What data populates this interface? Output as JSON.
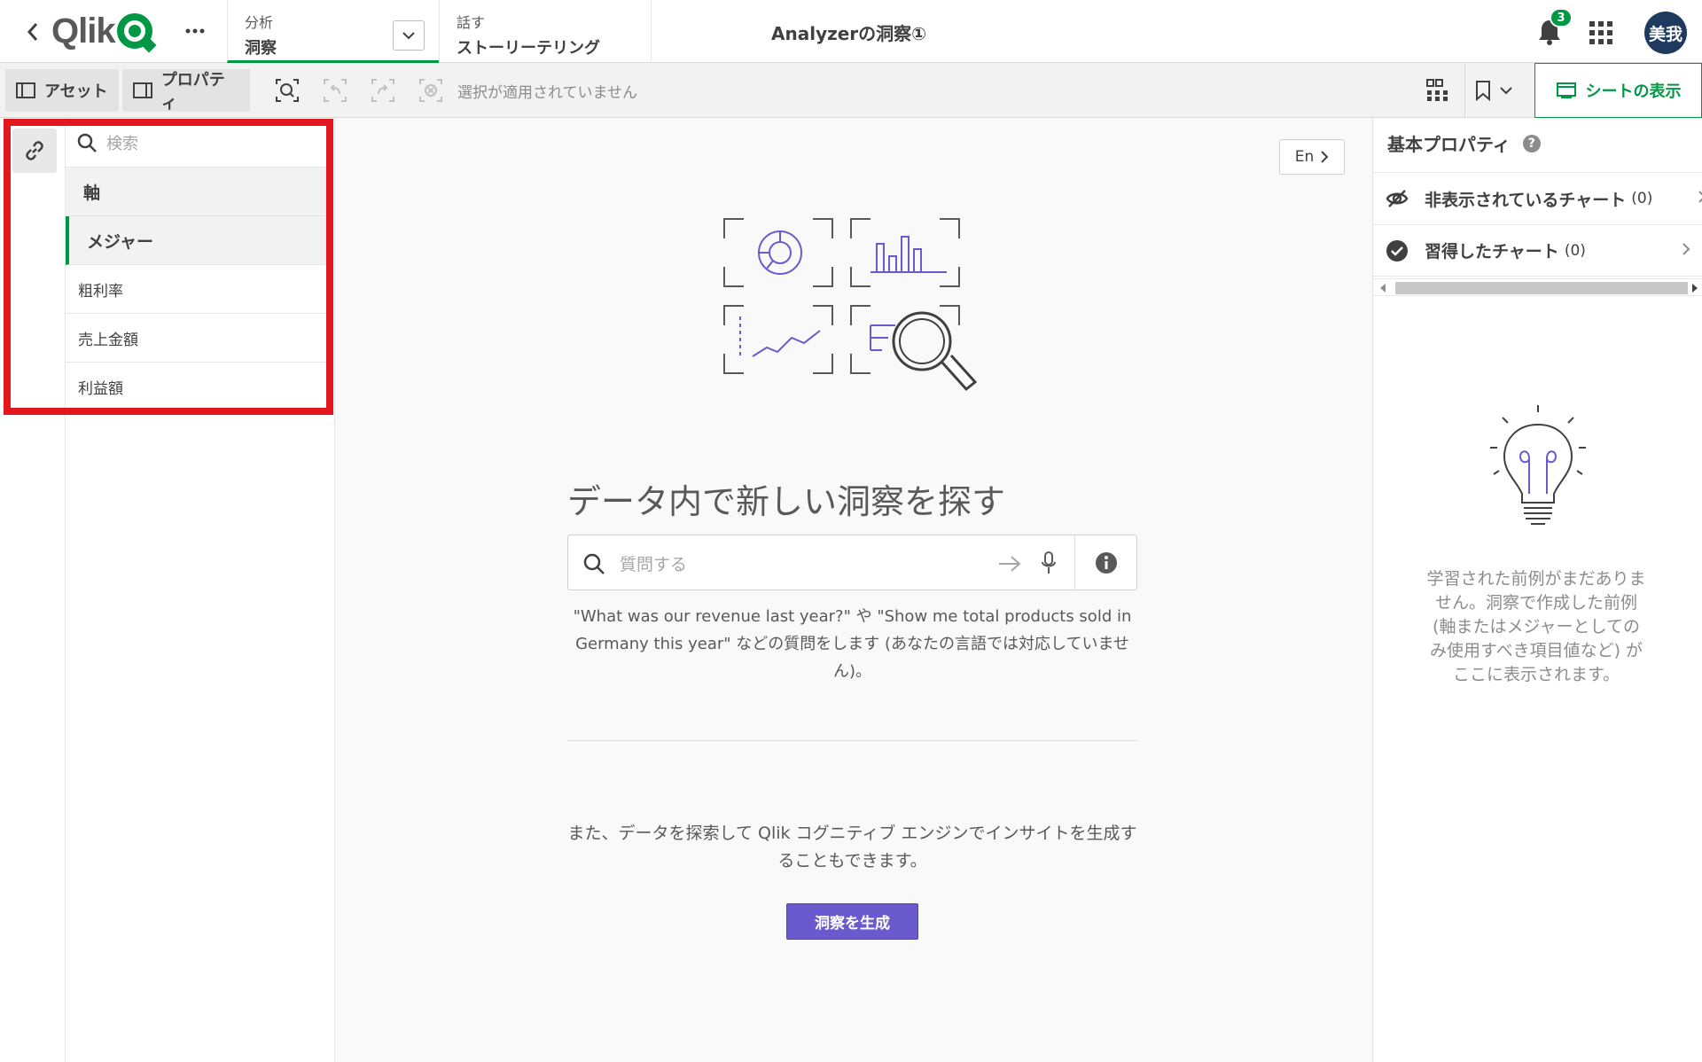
{
  "topbar": {
    "logo": "Qlik",
    "tabs": [
      {
        "small": "分析",
        "big": "洞察"
      },
      {
        "small": "話す",
        "big": "ストーリーテリング"
      }
    ],
    "app_title": "Analyzerの洞察①",
    "notification_count": "3",
    "avatar_initials": "美我"
  },
  "toolbar": {
    "assets_label": "アセット",
    "properties_label": "プロパティ",
    "selection_status": "選択が適用されていません",
    "sheet_view_label": "シートの表示"
  },
  "left_panel": {
    "search_placeholder": "検索",
    "sections": [
      "軸",
      "メジャー"
    ],
    "items": [
      "粗利率",
      "売上金額",
      "利益額"
    ]
  },
  "main": {
    "language_button": "En",
    "heading": "データ内で新しい洞察を探す",
    "ask_placeholder": "質問する",
    "hint": "\"What was our revenue last year?\" や \"Show me total products sold in Germany this year\" などの質問をします (あなたの言語では対応していません)。",
    "note": "また、データを探索して Qlik コグニティブ エンジンでインサイトを生成することもできます。",
    "generate_button": "洞察を生成"
  },
  "right_panel": {
    "title": "基本プロパティ",
    "rows": [
      {
        "label": "非表示されているチャート",
        "count": "(0)"
      },
      {
        "label": "習得したチャート",
        "count": "(0)"
      }
    ],
    "empty_message": "学習された前例がまだありません。洞察で作成した前例 (軸またはメジャーとしてのみ使用すべき項目値など) がここに表示されます。"
  },
  "colors": {
    "qlik_green": "#009845",
    "accent_purple": "#6a5acd",
    "highlight_red": "#e4161e"
  }
}
